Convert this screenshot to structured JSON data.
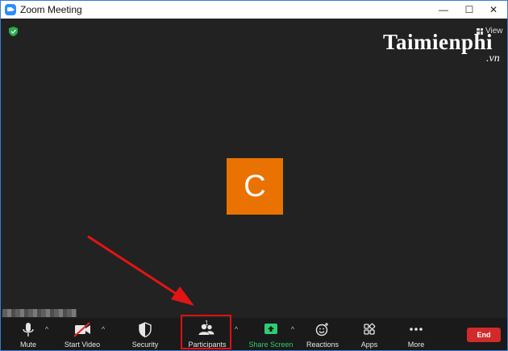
{
  "window": {
    "title": "Zoom Meeting",
    "minimize_glyph": "—",
    "maximize_glyph": "☐",
    "close_glyph": "✕"
  },
  "stage": {
    "view_label": "View",
    "watermark_main": "Taimienphi",
    "watermark_sub": ".vn",
    "participant_initial": "C",
    "avatar_color": "#ea7200"
  },
  "toolbar": {
    "mute_label": "Mute",
    "start_video_label": "Start Video",
    "security_label": "Security",
    "participants_label": "Participants",
    "participants_count": "1",
    "share_screen_label": "Share Screen",
    "reactions_label": "Reactions",
    "apps_label": "Apps",
    "more_label": "More",
    "end_label": "End",
    "caret_glyph": "^",
    "share_color": "#2ecc71",
    "end_color": "#d12a2a"
  },
  "annotation": {
    "highlight_color": "#e01010"
  }
}
